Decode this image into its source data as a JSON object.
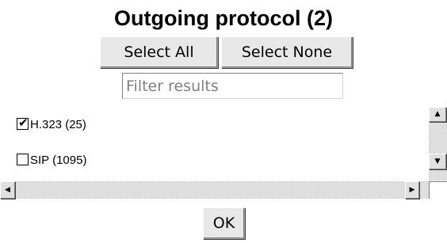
{
  "dialog": {
    "title": "Outgoing protocol (2)"
  },
  "buttons": {
    "select_all": "Select All",
    "select_none": "Select None",
    "ok": "OK"
  },
  "filter": {
    "placeholder": "Filter results",
    "value": ""
  },
  "items": [
    {
      "label": "H.323 (25)",
      "checked": true,
      "check_glyph": "✔"
    },
    {
      "label": "SIP (1095)",
      "checked": false,
      "check_glyph": ""
    }
  ],
  "scrollbars": {
    "up_icon": "▲",
    "down_icon": "▼",
    "left_icon": "◀",
    "right_icon": "▶"
  }
}
